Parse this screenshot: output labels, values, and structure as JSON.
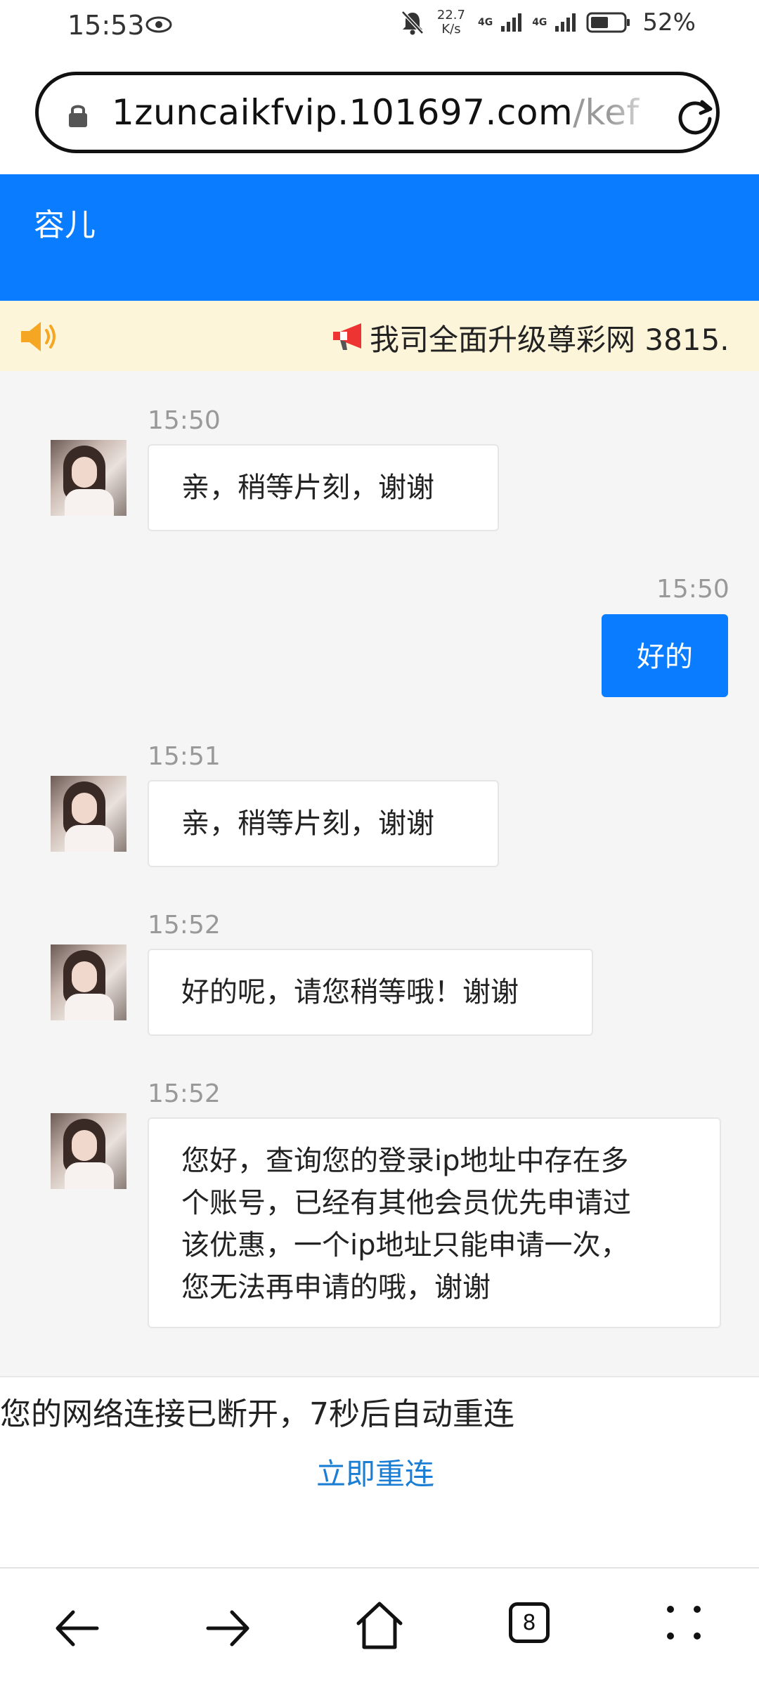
{
  "status_bar": {
    "time": "15:53",
    "speed": "22.7",
    "speed_unit": "K/s",
    "network_1": "4G",
    "network_2": "4G",
    "battery": "52%"
  },
  "browser": {
    "url_host": "1zuncaikfvip.101697.com",
    "url_path": "/kef"
  },
  "chat_header": {
    "title": "容儿"
  },
  "notice": {
    "text": "我司全面升级尊彩网 3815."
  },
  "messages": [
    {
      "time": "15:50",
      "sender": "agent",
      "text": "亲，稍等片刻，谢谢"
    },
    {
      "time": "15:50",
      "sender": "me",
      "text": "好的"
    },
    {
      "time": "15:51",
      "sender": "agent",
      "text": "亲，稍等片刻，谢谢"
    },
    {
      "time": "15:52",
      "sender": "agent",
      "text": "好的呢，请您稍等哦！谢谢"
    },
    {
      "time": "15:52",
      "sender": "agent",
      "lines": [
        "您好，查询您的登录ip地址中存在多",
        "个账号，已经有其他会员优先申请过",
        "该优惠，一个ip地址只能申请一次，",
        "您无法再申请的哦，谢谢"
      ]
    }
  ],
  "disconnect": {
    "message": "您的网络连接已断开，7秒后自动重连",
    "reconnect_label": "立即重连"
  },
  "bottom_nav": {
    "tabs_count": "8",
    "icons": [
      "back-arrow-icon",
      "forward-arrow-icon",
      "home-icon",
      "tabs-icon",
      "more-icon"
    ]
  },
  "colors": {
    "accent": "#0a7cff",
    "notice_bg": "#fdf5da",
    "link": "#1a7fd4"
  }
}
